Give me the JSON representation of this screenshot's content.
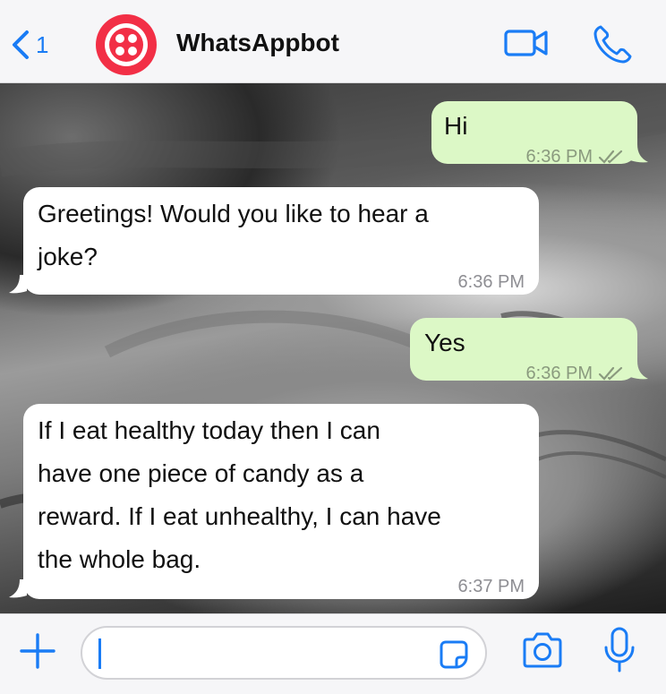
{
  "header": {
    "back_count": "1",
    "contact_name": "WhatsAppbot"
  },
  "messages": [
    {
      "direction": "outgoing",
      "text": "Hi",
      "time": "6:36 PM",
      "status": "read"
    },
    {
      "direction": "incoming",
      "text_lines": [
        "Greetings! Would you like to hear a",
        "joke?"
      ],
      "time": "6:36 PM"
    },
    {
      "direction": "outgoing",
      "text": "Yes",
      "time": "6:36 PM",
      "status": "read"
    },
    {
      "direction": "incoming",
      "text_lines": [
        "If I eat healthy today then I can",
        "have one piece of candy as a",
        "reward. If I eat unhealthy, I can have",
        "the whole bag."
      ],
      "time": "6:37 PM"
    }
  ],
  "input": {
    "value": "",
    "placeholder": ""
  },
  "icons": {
    "back": "chevron-left-icon",
    "avatar": "twilio-logo",
    "video": "video-camera-icon",
    "call": "phone-icon",
    "attach": "plus-icon",
    "sticker": "sticker-icon",
    "camera": "camera-icon",
    "mic": "microphone-icon"
  },
  "colors": {
    "accent": "#1a7cf5",
    "outgoing_bubble": "#dcf8c6",
    "incoming_bubble": "#ffffff",
    "avatar_red": "#f22f46"
  }
}
